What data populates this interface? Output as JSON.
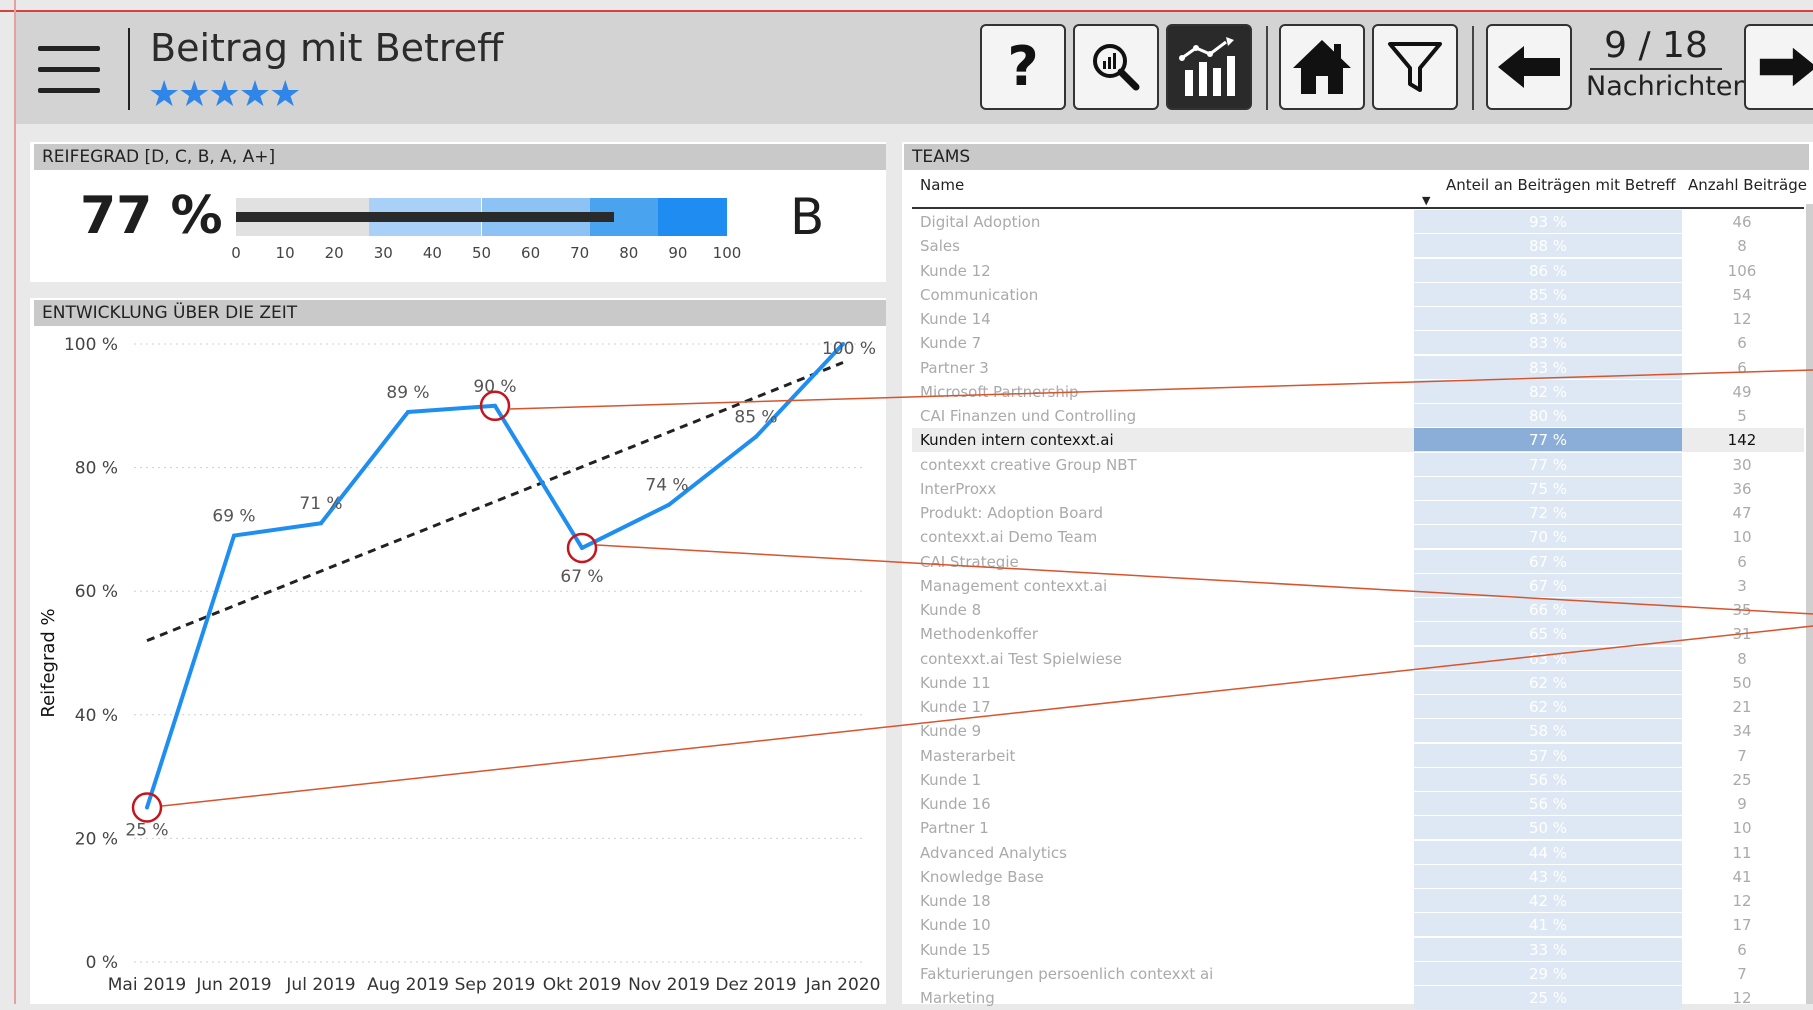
{
  "header": {
    "title": "Beitrag mit Betreff",
    "stars": "★★★★★",
    "help_glyph": "?",
    "pager_current": "9 / 18",
    "pager_label": "Nachrichten",
    "toolbar_icons": [
      "help-icon",
      "analyze-icon",
      "chart-icon",
      "home-icon",
      "filter-icon",
      "arrow-left-icon",
      "arrow-right-icon"
    ]
  },
  "reifegrad": {
    "title": "REIFEGRAD [D, C, B, A, A+]",
    "value_text": "77 %",
    "grade": "B",
    "value": 77,
    "bands": [
      27,
      50,
      72,
      86,
      100
    ],
    "band_colors": [
      "#e1e1e1",
      "#a9d1f7",
      "#8cc3f4",
      "#4aa3ef",
      "#1e8cf0"
    ],
    "ticks": [
      "0",
      "10",
      "20",
      "30",
      "40",
      "50",
      "60",
      "70",
      "80",
      "90",
      "100"
    ]
  },
  "entwicklung": {
    "title": "ENTWICKLUNG ÜBER DIE ZEIT"
  },
  "chart_data": {
    "type": "line",
    "ylabel": "Reifegrad %",
    "xlabel": "",
    "ylim": [
      0,
      100
    ],
    "y_ticks": [
      "0 %",
      "20 %",
      "40 %",
      "60 %",
      "80 %",
      "100 %"
    ],
    "categories": [
      "Mai 2019",
      "Jun 2019",
      "Jul 2019",
      "Aug 2019",
      "Sep 2019",
      "Okt 2019",
      "Nov 2019",
      "Dez 2019",
      "Jan 2020"
    ],
    "series": [
      {
        "values": [
          25,
          69,
          71,
          89,
          90,
          67,
          74,
          85,
          100
        ],
        "labels": [
          "25 %",
          "69 %",
          "71 %",
          "89 %",
          "90 %",
          "67 %",
          "74 %",
          "85 %",
          "100 %"
        ],
        "color": "#1f8ef1"
      }
    ],
    "trendline": {
      "start": 52,
      "end": 97,
      "color": "#222"
    },
    "highlighted_points": [
      "Mai 2019",
      "Sep 2019",
      "Okt 2019"
    ],
    "grid": true
  },
  "teams": {
    "title": "TEAMS",
    "columns": [
      "Name",
      "Anteil an Beiträgen mit Betreff",
      "Anzahl Beiträge"
    ],
    "rows": [
      {
        "name": "Digital Adoption",
        "share": "93 %",
        "count": "46"
      },
      {
        "name": "Sales",
        "share": "88 %",
        "count": "8"
      },
      {
        "name": "Kunde 12",
        "share": "86 %",
        "count": "106"
      },
      {
        "name": "Communication",
        "share": "85 %",
        "count": "54"
      },
      {
        "name": "Kunde 14",
        "share": "83 %",
        "count": "12"
      },
      {
        "name": "Kunde 7",
        "share": "83 %",
        "count": "6"
      },
      {
        "name": "Partner 3",
        "share": "83 %",
        "count": "6"
      },
      {
        "name": "Microsoft Partnership",
        "share": "82 %",
        "count": "49"
      },
      {
        "name": "CAI Finanzen und Controlling",
        "share": "80 %",
        "count": "5"
      },
      {
        "name": "Kunden intern contexxt.ai",
        "share": "77 %",
        "count": "142",
        "selected": true
      },
      {
        "name": "contexxt creative Group NBT",
        "share": "77 %",
        "count": "30"
      },
      {
        "name": "InterProxx",
        "share": "75 %",
        "count": "36"
      },
      {
        "name": "Produkt: Adoption Board",
        "share": "72 %",
        "count": "47"
      },
      {
        "name": "contexxt.ai Demo Team",
        "share": "70 %",
        "count": "10"
      },
      {
        "name": "CAI Strategie",
        "share": "67 %",
        "count": "6"
      },
      {
        "name": "Management contexxt.ai",
        "share": "67 %",
        "count": "3"
      },
      {
        "name": "Kunde 8",
        "share": "66 %",
        "count": "35"
      },
      {
        "name": "Methodenkoffer",
        "share": "65 %",
        "count": "31"
      },
      {
        "name": "contexxt.ai Test Spielwiese",
        "share": "63 %",
        "count": "8"
      },
      {
        "name": "Kunde 11",
        "share": "62 %",
        "count": "50"
      },
      {
        "name": "Kunde 17",
        "share": "62 %",
        "count": "21"
      },
      {
        "name": "Kunde 9",
        "share": "58 %",
        "count": "34"
      },
      {
        "name": "Masterarbeit",
        "share": "57 %",
        "count": "7"
      },
      {
        "name": "Kunde 1",
        "share": "56 %",
        "count": "25"
      },
      {
        "name": "Kunde 16",
        "share": "56 %",
        "count": "9"
      },
      {
        "name": "Partner 1",
        "share": "50 %",
        "count": "10"
      },
      {
        "name": "Advanced Analytics",
        "share": "44 %",
        "count": "11"
      },
      {
        "name": "Knowledge Base",
        "share": "43 %",
        "count": "41"
      },
      {
        "name": "Kunde 18",
        "share": "42 %",
        "count": "12"
      },
      {
        "name": "Kunde 10",
        "share": "41 %",
        "count": "17"
      },
      {
        "name": "Kunde 15",
        "share": "33 %",
        "count": "6"
      },
      {
        "name": "Fakturierungen persoenlich contexxt ai",
        "share": "29 %",
        "count": "7"
      },
      {
        "name": "Marketing",
        "share": "25 %",
        "count": "12"
      }
    ]
  }
}
